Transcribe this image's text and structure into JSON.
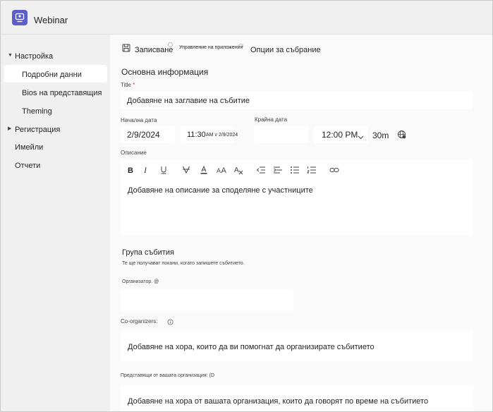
{
  "header": {
    "title": "Webinar",
    "app_icon": "webinar-app-icon",
    "accent": "#5b5fc7"
  },
  "sidebar": {
    "items": [
      {
        "label": "Настройка",
        "expandable": true,
        "expanded": true
      },
      {
        "label": "Подробни данни",
        "selected": true
      },
      {
        "label": "Bios на представящия"
      },
      {
        "label": "Theming"
      },
      {
        "label": "Регистрация",
        "expandable": true,
        "expanded": false
      },
      {
        "label": "Имейли"
      },
      {
        "label": "Отчети"
      }
    ]
  },
  "toolbar": {
    "save_label": "Записване",
    "manage_apps_label": "Управление на приложения",
    "meeting_options_label": "Опции за събрание"
  },
  "form": {
    "basic_info_title": "Основна информация",
    "title_label": "Title",
    "title_required_mark": "*",
    "title_placeholder": "Добавяне на заглавие на събитие",
    "start_date_label": "Начална дата",
    "start_date_value": "2/9/2024",
    "start_time_value": "11:30",
    "start_time_suffix": "AM v 2/9/2024",
    "end_date_label": "Крайна дата",
    "end_time_value": "12:00 PM",
    "duration": "30m",
    "description_label": "Описание",
    "description_placeholder": "Добавяне на описание за споделяне с участниците",
    "rte_tools": [
      "bold-icon",
      "italic-icon",
      "underline-icon",
      "strikethrough-icon",
      "highlight-icon",
      "font-size-icon",
      "clear-format-icon",
      "decrease-indent-icon",
      "increase-indent-icon",
      "bullet-list-icon",
      "numbered-list-icon",
      "link-icon"
    ],
    "event_group_title": "Група събития",
    "event_group_subtitle": "Те ще получават покани, когато запишете събитието.",
    "organizer_label": "Организатор. @",
    "co_organizers_label": "Co-organizers:",
    "co_organizers_placeholder": "Добавяне на хора, които да ви помогнат да организирате събитието",
    "presenters_label": "Представящи  от  вашата организация:  (D",
    "presenters_placeholder": "Добавяне на хора от вашата организация, които да говорят по време на събитието"
  }
}
